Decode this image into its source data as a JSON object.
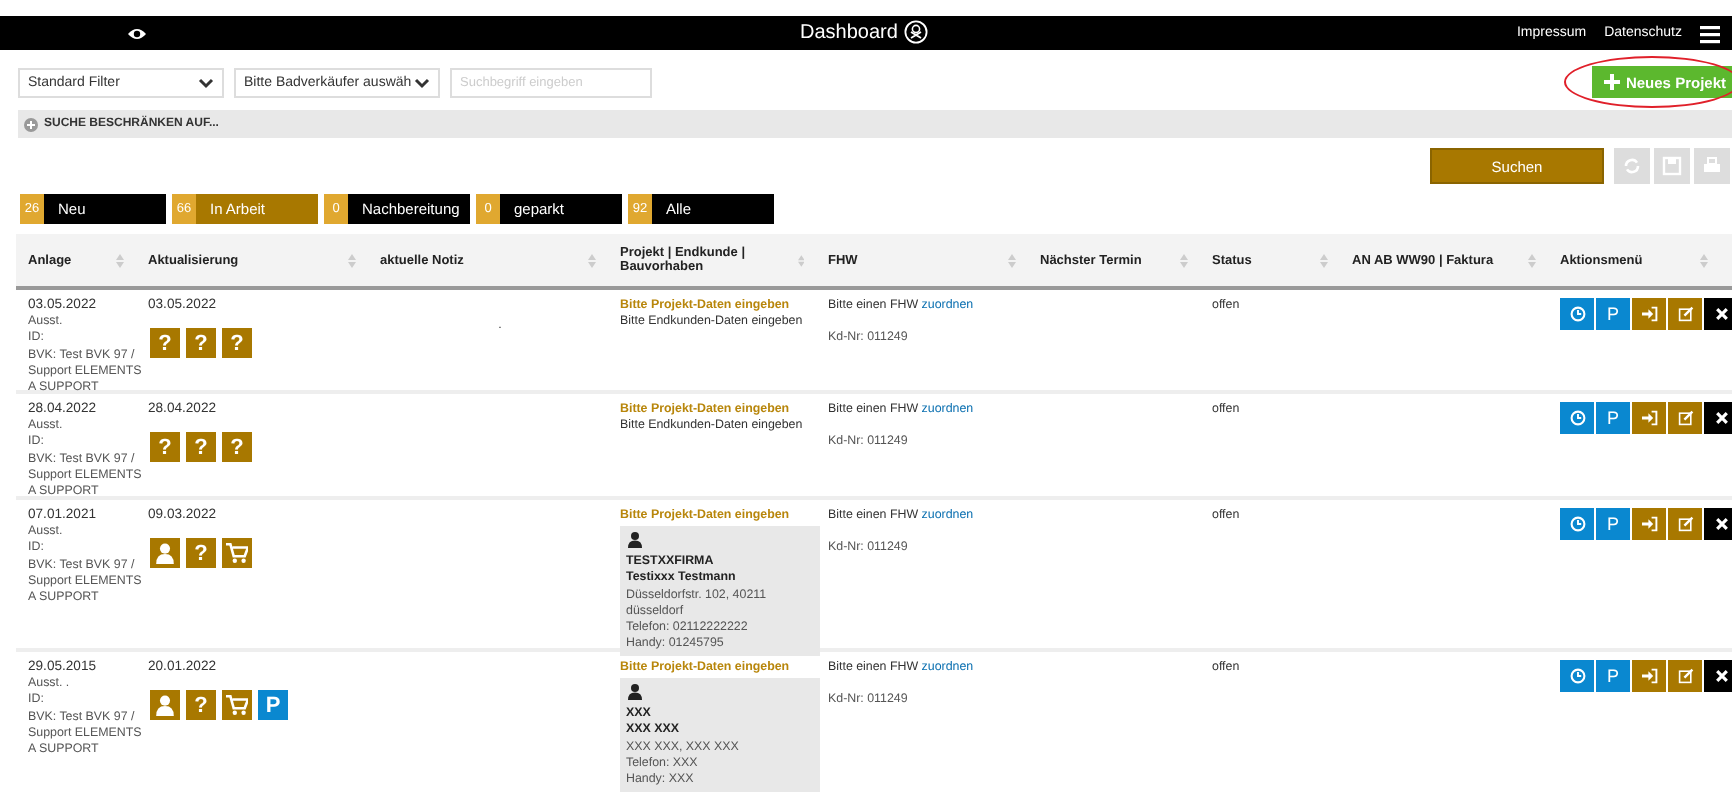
{
  "header": {
    "title": "Dashboard",
    "links": [
      "Impressum",
      "Datenschutz"
    ]
  },
  "filters": {
    "filter_select": "Standard Filter",
    "seller_select": "Bitte Badverkäufer auswäh",
    "search": {
      "placeholder": "Suchbegriff eingeben"
    },
    "new_button": "Neues Projekt"
  },
  "restrict_bar": "SUCHE BESCHRÄNKEN AUF...",
  "search_button": "Suchen",
  "tabs": [
    {
      "count": "26",
      "label": "Neu",
      "selected": false
    },
    {
      "count": "66",
      "label": "In Arbeit",
      "selected": true
    },
    {
      "count": "0",
      "label": "Nachbereitung",
      "selected": false
    },
    {
      "count": "0",
      "label": "geparkt",
      "selected": false
    },
    {
      "count": "92",
      "label": "Alle",
      "selected": false
    }
  ],
  "table": {
    "columns": [
      "Anlage",
      "Aktualisierung",
      "aktuelle Notiz",
      "Projekt | Endkunde | Bauvorhaben",
      "FHW",
      "Nächster Termin",
      "Status",
      "AN AB WW90 | Faktura",
      "Aktionsmenü"
    ],
    "rows": [
      {
        "created": "03.05.2022",
        "created_lines": [
          "Ausst.",
          "ID:",
          "BVK: Test BVK 97 / Support ELEMENTS A SUPPORT"
        ],
        "updated": "03.05.2022",
        "icons": [
          {
            "kind": "question",
            "glyph": "?"
          },
          {
            "kind": "question",
            "glyph": "?"
          },
          {
            "kind": "question",
            "glyph": "?"
          }
        ],
        "note": ".",
        "project": "Bitte Projekt-Daten eingeben",
        "customer_text": "Bitte Endkunden-Daten eingeben",
        "fhw_text": "Bitte einen FHW",
        "fhw_link": "zuordnen",
        "kd_nr": "Kd-Nr: 011249",
        "status": "offen",
        "actions": [
          {
            "kind": "clock"
          },
          {
            "kind": "p",
            "glyph": "P"
          },
          {
            "kind": "login"
          },
          {
            "kind": "edit"
          },
          {
            "kind": "delete"
          }
        ]
      },
      {
        "created": "28.04.2022",
        "created_lines": [
          "Ausst.",
          "ID:",
          "BVK: Test BVK 97 / Support ELEMENTS A SUPPORT"
        ],
        "updated": "28.04.2022",
        "icons": [
          {
            "kind": "question",
            "glyph": "?"
          },
          {
            "kind": "question",
            "glyph": "?"
          },
          {
            "kind": "question",
            "glyph": "?"
          }
        ],
        "project": "Bitte Projekt-Daten eingeben",
        "customer_text": "Bitte Endkunden-Daten eingeben",
        "fhw_text": "Bitte einen FHW",
        "fhw_link": "zuordnen",
        "kd_nr": "Kd-Nr: 011249",
        "status": "offen",
        "actions": [
          {
            "kind": "clock"
          },
          {
            "kind": "p",
            "glyph": "P"
          },
          {
            "kind": "login"
          },
          {
            "kind": "edit"
          },
          {
            "kind": "delete"
          }
        ]
      },
      {
        "created": "07.01.2021",
        "created_lines": [
          "Ausst.",
          "ID:",
          "BVK: Test BVK 97 / Support ELEMENTS A SUPPORT"
        ],
        "updated": "09.03.2022",
        "icons": [
          {
            "kind": "person"
          },
          {
            "kind": "question",
            "glyph": "?"
          },
          {
            "kind": "cart"
          }
        ],
        "project": "Bitte Projekt-Daten eingeben",
        "customer_card": [
          {
            "kind": "bold",
            "text": "TESTXXFIRMA"
          },
          {
            "kind": "bold",
            "text": "Testixxx Testmann"
          },
          {
            "kind": "plain",
            "text": "Düsseldorfstr. 102, 40211"
          },
          {
            "kind": "plain",
            "text": "düsseldorf"
          },
          {
            "kind": "plain",
            "text": "Telefon: 02112222222"
          },
          {
            "kind": "plain",
            "text": "Handy: 01245795"
          }
        ],
        "fhw_text": "Bitte einen FHW",
        "fhw_link": "zuordnen",
        "kd_nr": "Kd-Nr: 011249",
        "status": "offen",
        "actions": [
          {
            "kind": "clock"
          },
          {
            "kind": "p",
            "glyph": "P"
          },
          {
            "kind": "login"
          },
          {
            "kind": "edit"
          },
          {
            "kind": "delete"
          }
        ]
      },
      {
        "created": "29.05.2015",
        "created_lines": [
          "Ausst. .",
          "ID:",
          "BVK: Test BVK 97 / Support ELEMENTS A SUPPORT"
        ],
        "updated": "20.01.2022",
        "icons": [
          {
            "kind": "person"
          },
          {
            "kind": "question",
            "glyph": "?"
          },
          {
            "kind": "cart"
          },
          {
            "kind": "p",
            "glyph": "P"
          }
        ],
        "project": "Bitte Projekt-Daten eingeben",
        "customer_card": [
          {
            "kind": "bold",
            "text": "XXX"
          },
          {
            "kind": "bold",
            "text": "XXX XXX"
          },
          {
            "kind": "plain",
            "text": "XXX XXX, XXX XXX"
          },
          {
            "kind": "plain",
            "text": "Telefon: XXX"
          },
          {
            "kind": "plain",
            "text": "Handy: XXX"
          }
        ],
        "fhw_text": "Bitte einen FHW",
        "fhw_link": "zuordnen",
        "kd_nr": "Kd-Nr: 011249",
        "status": "offen",
        "actions": [
          {
            "kind": "clock"
          },
          {
            "kind": "p",
            "glyph": "P"
          },
          {
            "kind": "login"
          },
          {
            "kind": "edit"
          },
          {
            "kind": "delete"
          }
        ]
      }
    ]
  }
}
